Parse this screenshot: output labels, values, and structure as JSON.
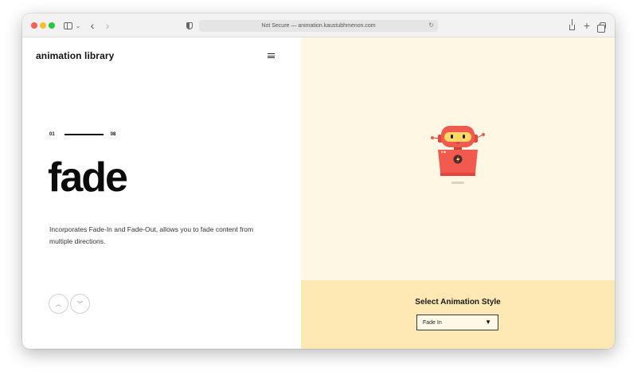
{
  "browser": {
    "address": "Not Secure — animation.kaustubhmenon.com",
    "reload_icon": "↻",
    "back_icon": "‹",
    "forward_icon": "›",
    "new_tab_icon": "+",
    "sidebar_chevron_icon": "⌄"
  },
  "site": {
    "brand": "animation library",
    "counter_start": "01",
    "counter_end": "08",
    "headline": "fade",
    "description": "Incorporates Fade-In and Fade-Out, allows you to fade content from multiple directions.",
    "nav_up_icon": "︿",
    "nav_down_icon": "﹀"
  },
  "panel": {
    "title": "Select Animation Style",
    "selected_option": "Fade In",
    "select_arrow": "▼"
  },
  "colors": {
    "stage_bg": "#fef7e4",
    "panel_bg": "#fee8b3",
    "robot_red": "#f05a4f",
    "robot_visor": "#fdd866"
  }
}
